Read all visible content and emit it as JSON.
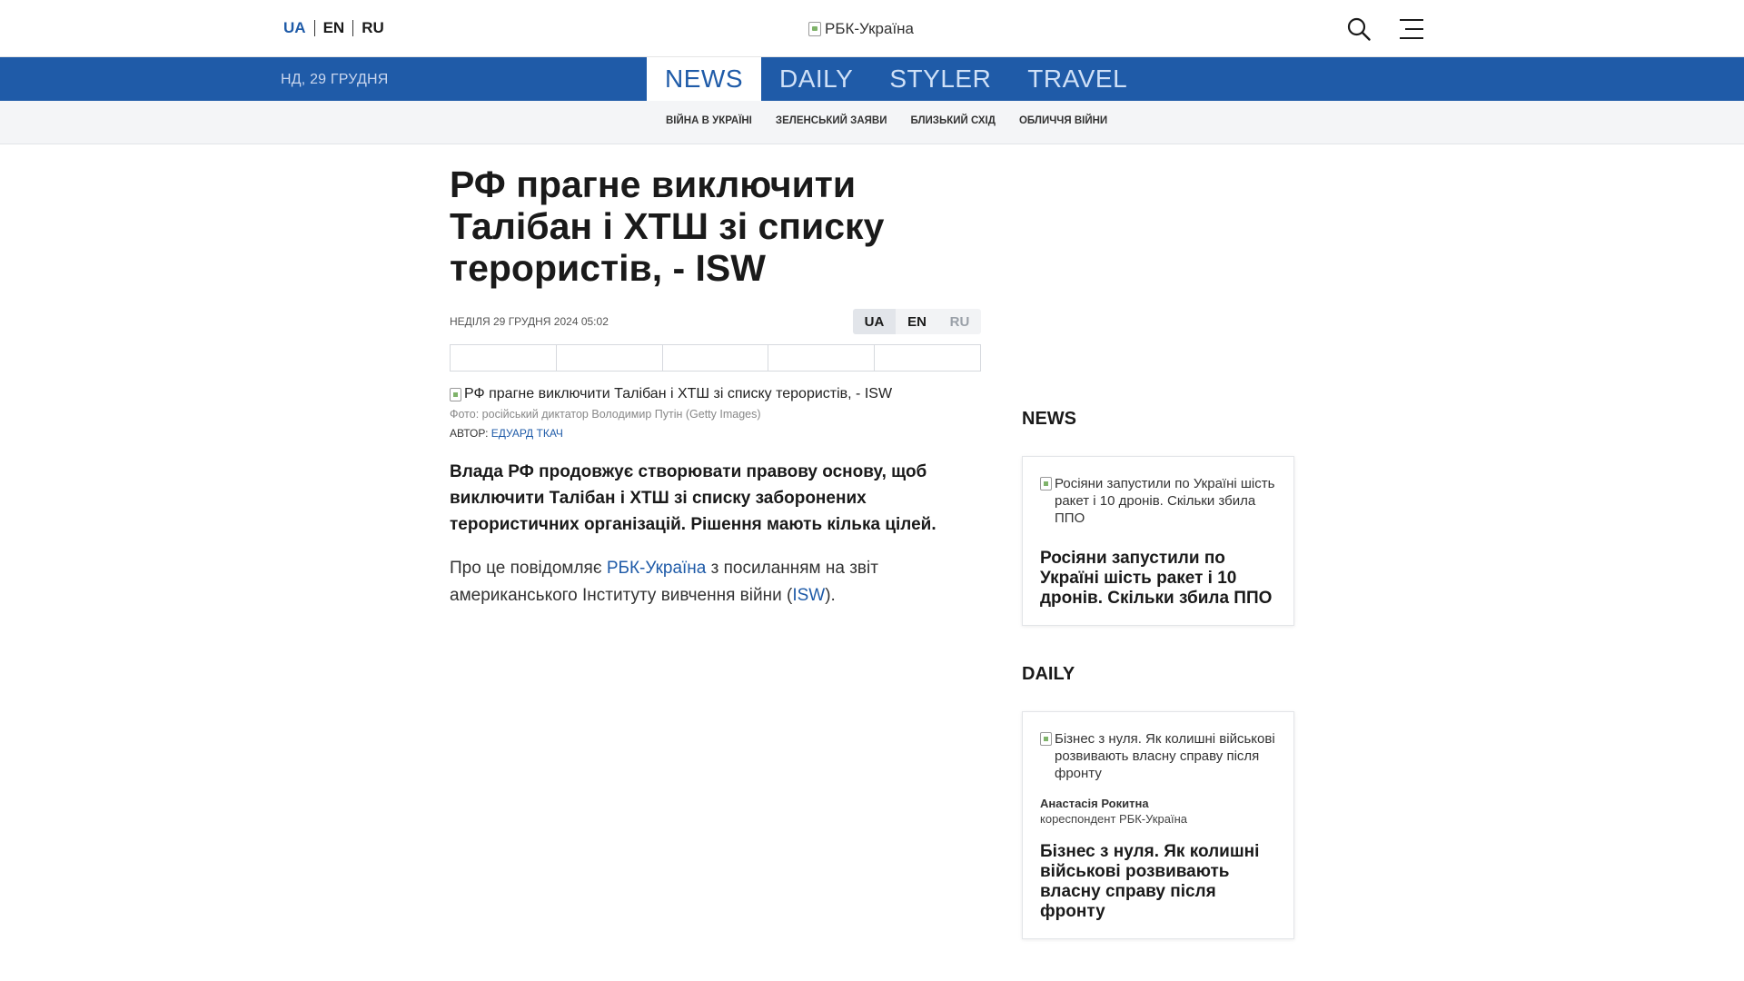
{
  "header": {
    "languages": [
      "UA",
      "EN",
      "RU"
    ],
    "logo_alt": "РБК-Україна",
    "icons": {
      "search": "search-icon",
      "menu": "menu-icon"
    }
  },
  "nav": {
    "date": "НД, 29 ГРУДНЯ",
    "sections": [
      {
        "label": "NEWS",
        "active": true
      },
      {
        "label": "DAILY",
        "active": false
      },
      {
        "label": "STYLER",
        "active": false
      },
      {
        "label": "TRAVEL",
        "active": false
      }
    ],
    "subnav": [
      "ВІЙНА В УКРАЇНІ",
      "ЗЕЛЕНСЬКИЙ ЗАЯВИ",
      "БЛИЗЬКИЙ СХІД",
      "ОБЛИЧЧЯ ВІЙНИ"
    ]
  },
  "article": {
    "title": "РФ прагне виключити Талібан і ХТШ зі списку терористів, - ISW",
    "date": "НЕДІЛЯ 29 ГРУДНЯ 2024 05:02",
    "languages": [
      "UA",
      "EN",
      "RU"
    ],
    "photo_alt": "РФ прагне виключити Талібан і ХТШ зі списку терористів, - ISW",
    "caption": "Фото: російський диктатор Володимир Путін (Getty Images)",
    "author_label": "АВТОР:",
    "author_name": "ЕДУАРД ТКАЧ",
    "lead": "Влада РФ продовжує створювати правову основу, щоб виключити Талібан і ХТШ зі списку заборонених терористичних організацій. Рішення мають кілька цілей.",
    "body_before": "Про це повідомляє ",
    "body_link1": "РБК-Україна",
    "body_middle": " з посиланням на звіт американського Інституту вивчення війни (",
    "body_link2": "ISW",
    "body_after": ")."
  },
  "sidebar": {
    "news_heading": "NEWS",
    "news_card": {
      "img_alt": "Росіяни запустили по Україні шість ракет і 10 дронів. Скільки збила ППО",
      "title": "Росіяни запустили по Україні шість ракет і 10 дронів. Скільки збила ППО"
    },
    "daily_heading": "DAILY",
    "daily_card": {
      "img_alt": "Бізнес з нуля. Як колишні військові розвивають власну справу після фронту",
      "author_name": "Анастасія Рокитна",
      "author_role": "кореспондент РБК-Україна",
      "title": "Бізнес з нуля. Як колишні військові розвивають власну справу після фронту"
    }
  },
  "colors": {
    "brand_blue": "#1f5ba8",
    "subnav_bg": "#f4f5f7"
  }
}
